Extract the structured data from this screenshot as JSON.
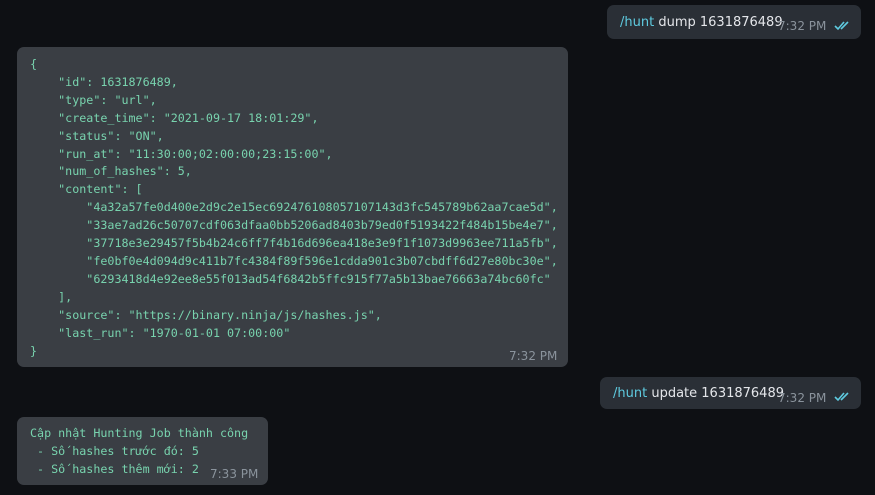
{
  "messages": [
    {
      "command": "/hunt",
      "args": "dump 1631876489",
      "time": "7:32 PM",
      "status_icon": "double-check-icon"
    },
    {
      "code": "{\n    \"id\": 1631876489,\n    \"type\": \"url\",\n    \"create_time\": \"2021-09-17 18:01:29\",\n    \"status\": \"ON\",\n    \"run_at\": \"11:30:00;02:00:00;23:15:00\",\n    \"num_of_hashes\": 5,\n    \"content\": [\n        \"4a32a57fe0d400e2d9c2e15ec692476108057107143d3fc545789b62aa7cae5d\",\n        \"33ae7ad26c50707cdf063dfaa0bb5206ad8403b79ed0f5193422f484b15be4e7\",\n        \"37718e3e29457f5b4b24c6ff7f4b16d696ea418e3e9f1f1073d9963ee711a5fb\",\n        \"fe0bf0e4d094d9c411b7fc4384f89f596e1cdda901c3b07cbdff6d27e80bc30e\",\n        \"6293418d4e92ee8e55f013ad54f6842b5ffc915f77a5b13bae76663a74bc60fc\"\n    ],\n    \"source\": \"https://binary.ninja/js/hashes.js\",\n    \"last_run\": \"1970-01-01 07:00:00\"\n}",
      "time": "7:32 PM"
    },
    {
      "command": "/hunt",
      "args": "update 1631876489",
      "time": "7:32 PM",
      "status_icon": "double-check-icon"
    },
    {
      "code": "Cập nhật Hunting Job thành công\n - Số hashes trước đó: 5\n - Số hashes thêm mới: 2",
      "time": "7:33 PM"
    }
  ],
  "colors": {
    "background": "#0e1014",
    "outgoing_bubble": "#2a2f36",
    "incoming_bubble": "#3a3e44",
    "command": "#5ecbe0",
    "code_text": "#78d3ae",
    "check": "#5ecbe0"
  }
}
